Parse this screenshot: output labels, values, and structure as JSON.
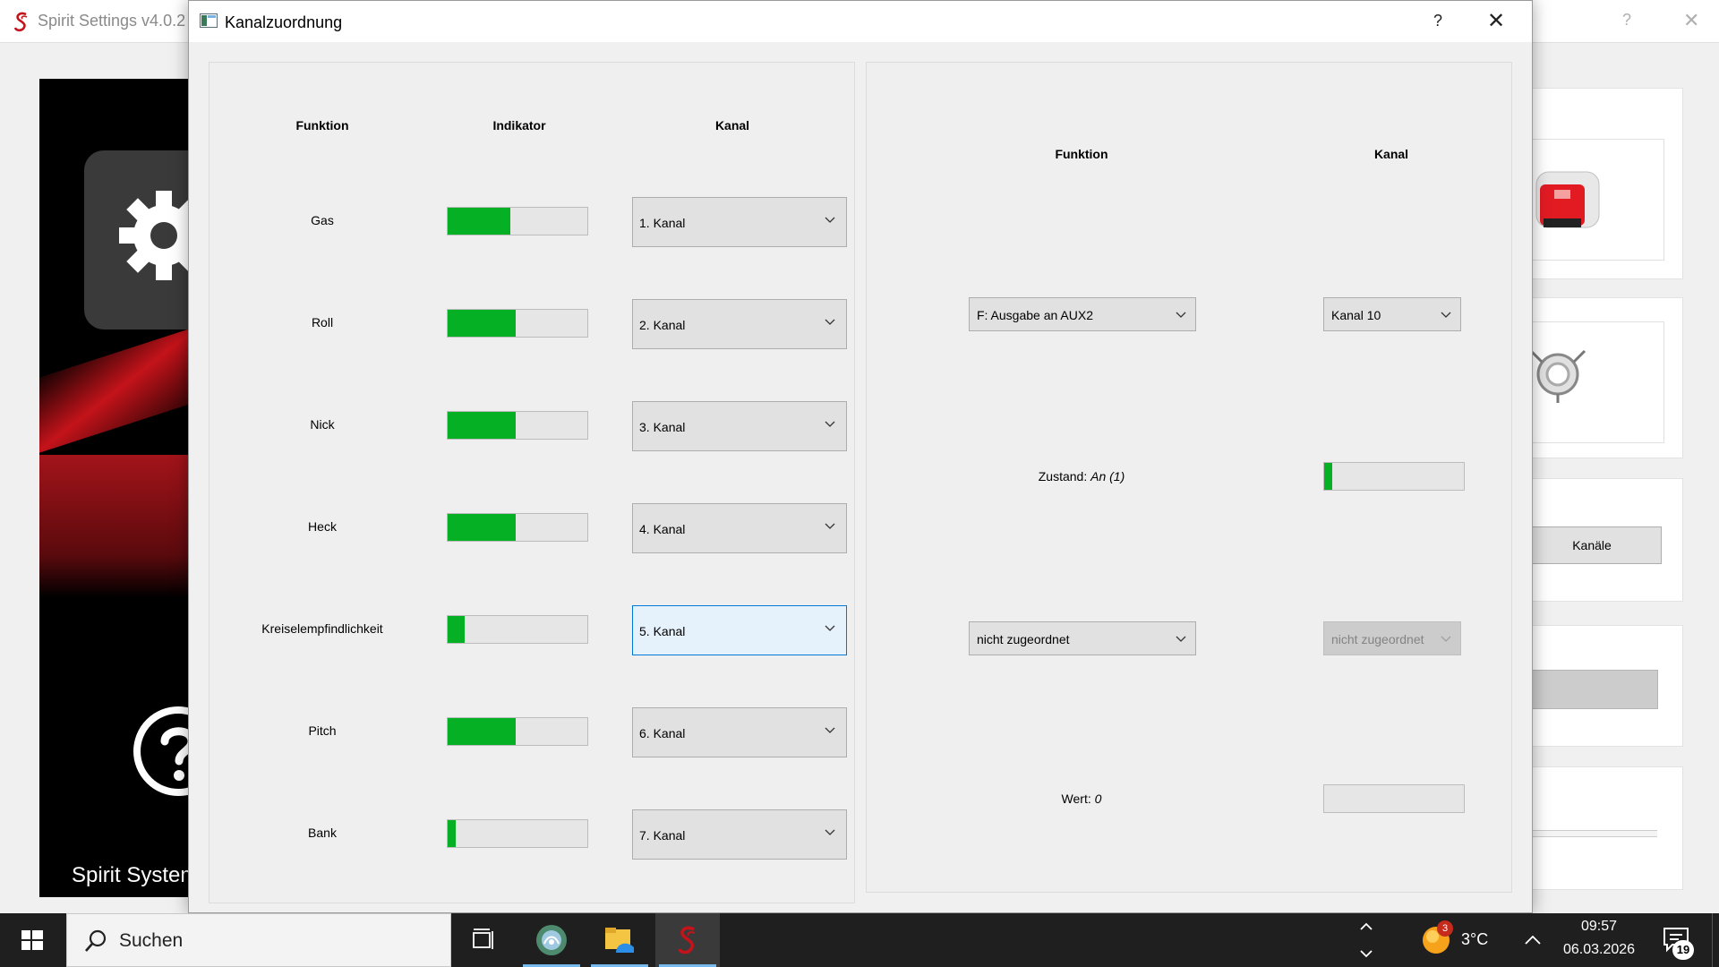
{
  "background_app": {
    "title": "Spirit Settings v4.0.2",
    "help_label": "?",
    "close_label": "✕",
    "sidebar_label": "Spirit System",
    "kanaele_button": "Kanäle"
  },
  "dialog": {
    "title": "Kanalzuordnung",
    "help_label": "?",
    "close_label": "✕",
    "left": {
      "headers": {
        "funktion": "Funktion",
        "indikator": "Indikator",
        "kanal": "Kanal"
      },
      "rows": [
        {
          "name": "Gas",
          "level": 0.45,
          "channel": "1. Kanal"
        },
        {
          "name": "Roll",
          "level": 0.49,
          "channel": "2. Kanal"
        },
        {
          "name": "Nick",
          "level": 0.49,
          "channel": "3. Kanal"
        },
        {
          "name": "Heck",
          "level": 0.49,
          "channel": "4. Kanal"
        },
        {
          "name": "Kreiselempfindlichkeit",
          "level": 0.12,
          "channel": "5. Kanal"
        },
        {
          "name": "Pitch",
          "level": 0.49,
          "channel": "6. Kanal"
        },
        {
          "name": "Bank",
          "level": 0.06,
          "channel": "7. Kanal"
        }
      ]
    },
    "right": {
      "headers": {
        "funktion": "Funktion",
        "kanal": "Kanal"
      },
      "function_select": "F: Ausgabe an AUX2",
      "channel_select": "Kanal 10",
      "state_label": "Zustand:",
      "state_value": "An (1)",
      "state_level": 0.06,
      "function2_select": "nicht zugeordnet",
      "channel2_select": "nicht zugeordnet",
      "value_label": "Wert:",
      "value_value": "0",
      "value_level": 0
    }
  },
  "taskbar": {
    "search_placeholder": "Suchen",
    "weather_badge": "3",
    "temperature": "3°C",
    "time": "09:57",
    "date": "06.03.2026",
    "notification_count": "19"
  },
  "colors": {
    "indicator_fill": "#06b025",
    "focus_border": "#0078d7",
    "brand_red": "#c4131a"
  }
}
